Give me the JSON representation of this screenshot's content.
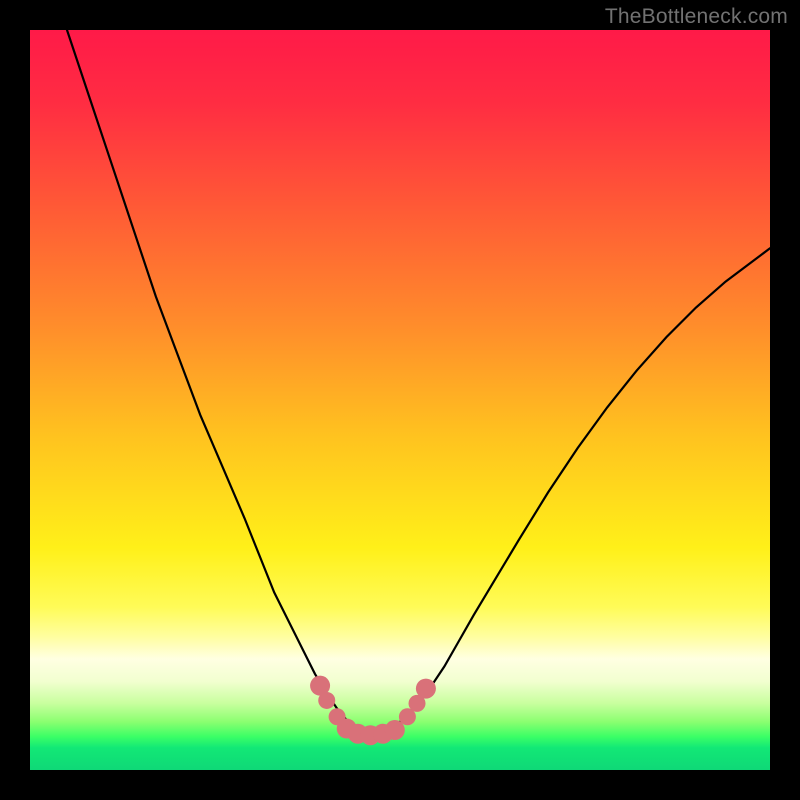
{
  "watermark": "TheBottleneck.com",
  "chart_data": {
    "type": "line",
    "title": "",
    "xlabel": "",
    "ylabel": "",
    "x_range": [
      0,
      100
    ],
    "y_range": [
      0,
      100
    ],
    "grid": false,
    "legend": false,
    "gradient_stops": [
      {
        "offset": 0.0,
        "color": "#ff1a48"
      },
      {
        "offset": 0.1,
        "color": "#ff2d42"
      },
      {
        "offset": 0.25,
        "color": "#ff5d35"
      },
      {
        "offset": 0.4,
        "color": "#ff8d2b"
      },
      {
        "offset": 0.55,
        "color": "#ffc31f"
      },
      {
        "offset": 0.7,
        "color": "#fff019"
      },
      {
        "offset": 0.78,
        "color": "#fffb58"
      },
      {
        "offset": 0.82,
        "color": "#fffea0"
      },
      {
        "offset": 0.85,
        "color": "#ffffe2"
      },
      {
        "offset": 0.88,
        "color": "#f2ffd0"
      },
      {
        "offset": 0.91,
        "color": "#c8ff9e"
      },
      {
        "offset": 0.935,
        "color": "#8aff70"
      },
      {
        "offset": 0.955,
        "color": "#3bff66"
      },
      {
        "offset": 0.97,
        "color": "#12e876"
      },
      {
        "offset": 1.0,
        "color": "#0fd877"
      }
    ],
    "series": [
      {
        "name": "left-curve",
        "x": [
          5,
          8,
          11,
          14,
          17,
          20,
          23,
          26,
          29,
          31,
          33,
          35,
          37,
          38.5,
          40,
          41.5,
          43
        ],
        "y": [
          100,
          91,
          82,
          73,
          64,
          56,
          48,
          41,
          34,
          29,
          24,
          20,
          16,
          13,
          10.5,
          8.3,
          6.5
        ]
      },
      {
        "name": "right-curve",
        "x": [
          50,
          52,
          54,
          56,
          58,
          60,
          63,
          66,
          70,
          74,
          78,
          82,
          86,
          90,
          94,
          98,
          100
        ],
        "y": [
          6.5,
          8.5,
          11,
          14,
          17.5,
          21,
          26,
          31,
          37.5,
          43.5,
          49,
          54,
          58.5,
          62.5,
          66,
          69,
          70.5
        ]
      }
    ],
    "markers": {
      "name": "bottom-dots",
      "color": "#d97179",
      "radius_large": 10,
      "radius_small": 8.5,
      "points": [
        {
          "x": 39.2,
          "y": 11.4,
          "r": "large"
        },
        {
          "x": 40.1,
          "y": 9.4,
          "r": "small"
        },
        {
          "x": 41.5,
          "y": 7.2,
          "r": "small"
        },
        {
          "x": 42.8,
          "y": 5.6,
          "r": "large"
        },
        {
          "x": 44.3,
          "y": 4.9,
          "r": "large"
        },
        {
          "x": 46.0,
          "y": 4.7,
          "r": "large"
        },
        {
          "x": 47.7,
          "y": 4.9,
          "r": "large"
        },
        {
          "x": 49.3,
          "y": 5.4,
          "r": "large"
        },
        {
          "x": 51.0,
          "y": 7.2,
          "r": "small"
        },
        {
          "x": 52.3,
          "y": 9.0,
          "r": "small"
        },
        {
          "x": 53.5,
          "y": 11.0,
          "r": "large"
        }
      ]
    }
  }
}
